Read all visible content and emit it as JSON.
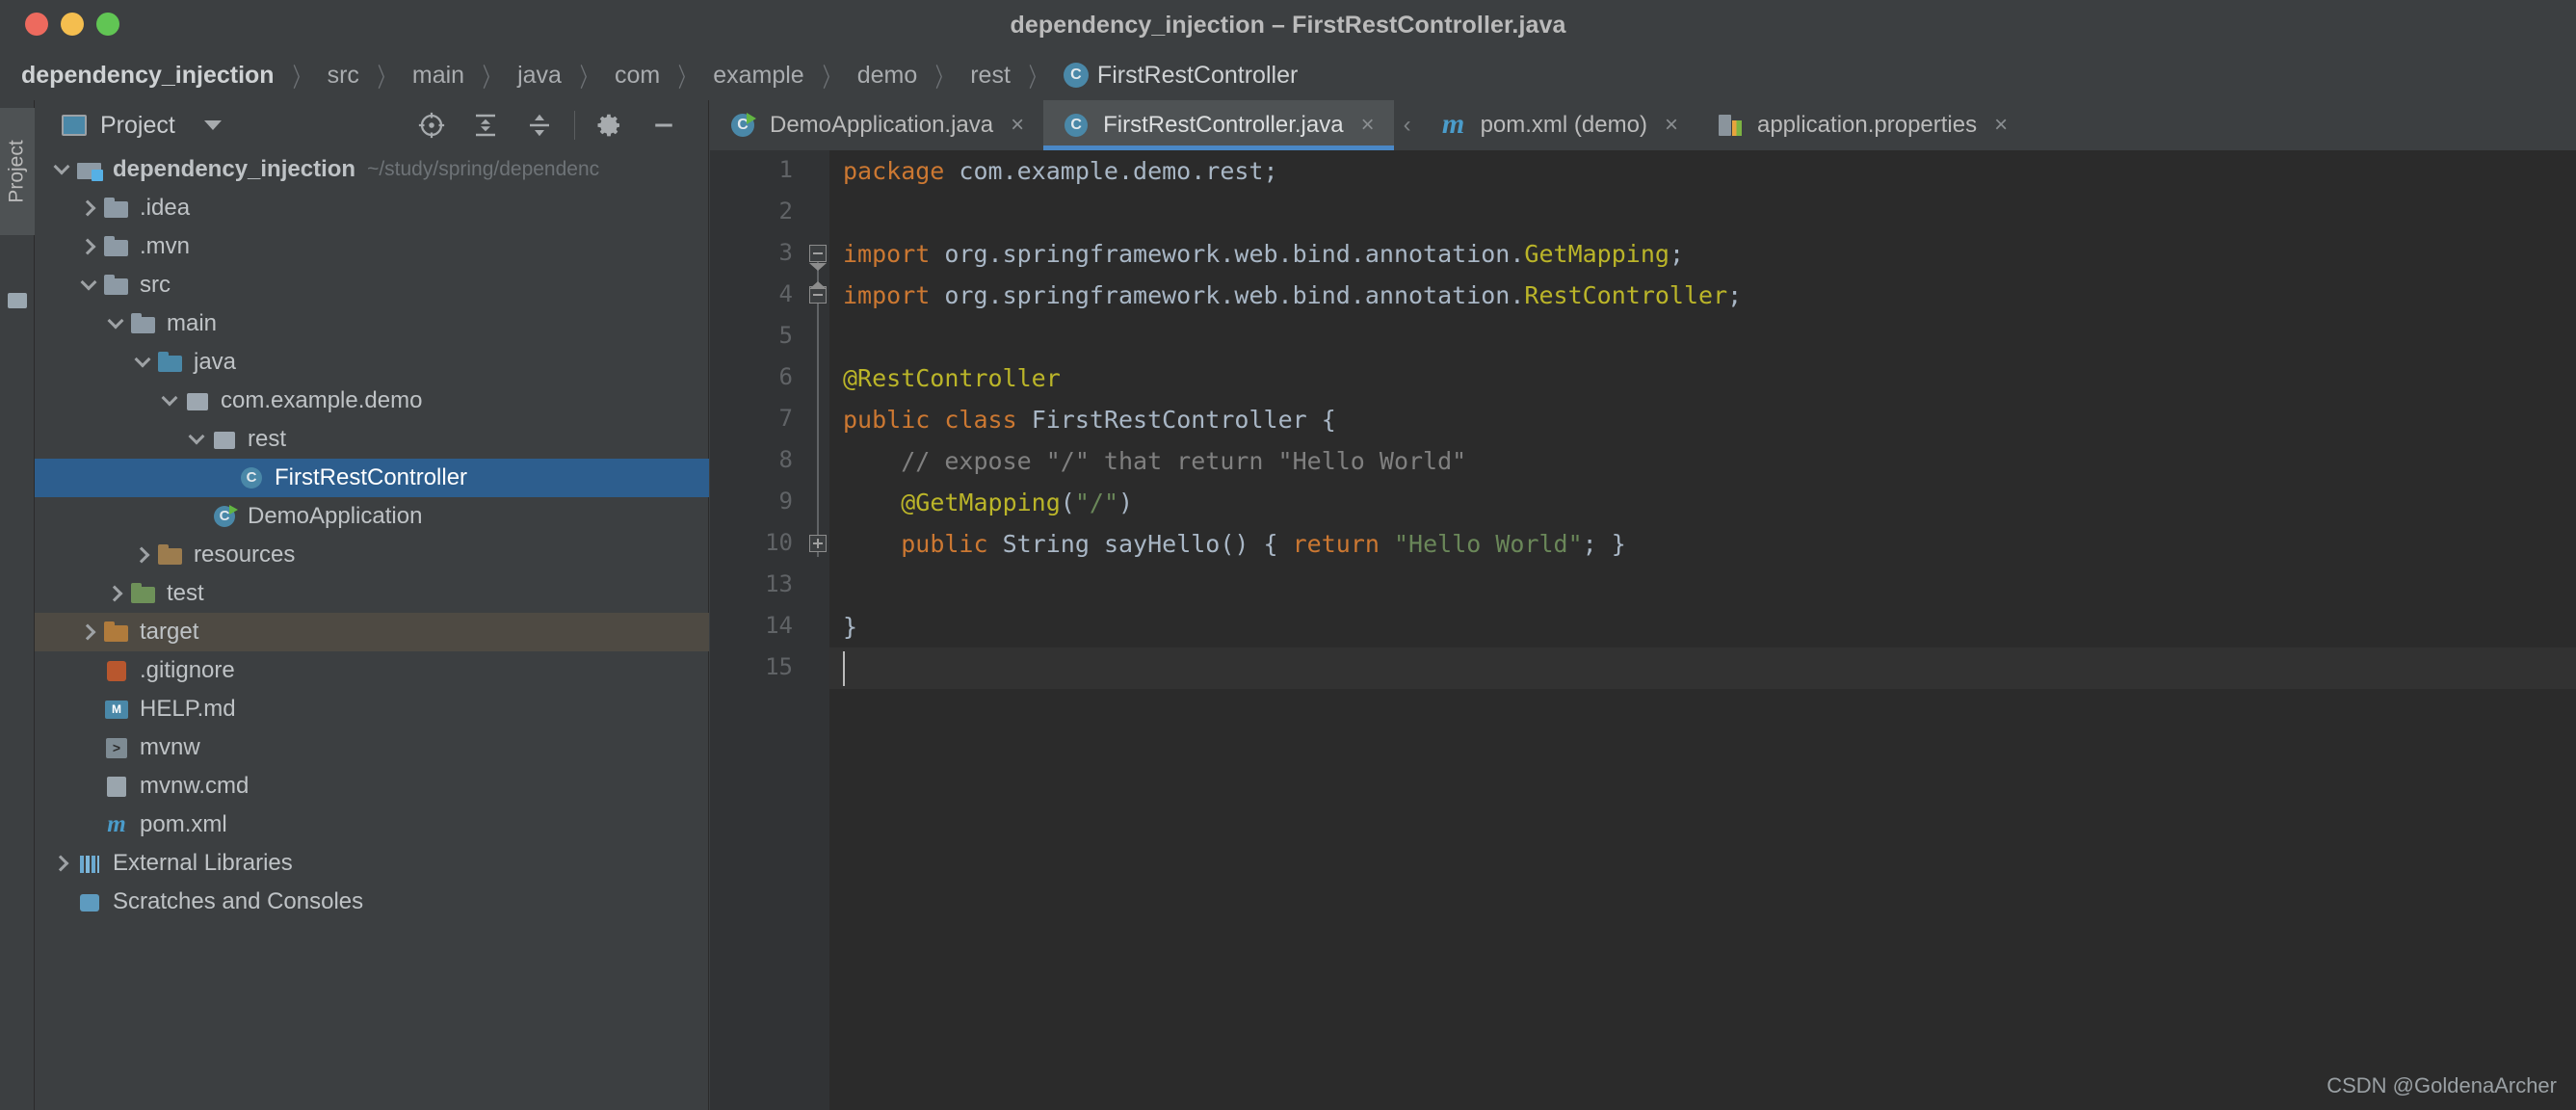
{
  "window": {
    "title": "dependency_injection – FirstRestController.java",
    "traffic_lights": [
      "close-red",
      "minimize-yellow",
      "zoom-green"
    ]
  },
  "breadcrumb": {
    "items": [
      "dependency_injection",
      "src",
      "main",
      "java",
      "com",
      "example",
      "demo",
      "rest"
    ],
    "current_class": "FirstRestController",
    "separator": "〉"
  },
  "left_strip": {
    "tool_tab": "Project"
  },
  "project_panel": {
    "title": "Project",
    "caret": "chevron-down-icon",
    "tools": [
      {
        "name": "locate-icon",
        "label": "Select Opened File"
      },
      {
        "name": "expand-all-icon",
        "label": "Expand All"
      },
      {
        "name": "collapse-all-icon",
        "label": "Collapse All"
      },
      {
        "name": "gear-icon",
        "label": "Settings"
      },
      {
        "name": "minimize-icon",
        "label": "Hide"
      }
    ],
    "tree": [
      {
        "label": "dependency_injection",
        "path_suffix": "~/study/spring/dependenc",
        "icon": "module",
        "arrow": "down",
        "indent": 0,
        "bold": true,
        "state": "normal"
      },
      {
        "label": ".idea",
        "icon": "folder",
        "arrow": "right",
        "indent": 1,
        "state": "normal"
      },
      {
        "label": ".mvn",
        "icon": "folder",
        "arrow": "right",
        "indent": 1,
        "state": "normal"
      },
      {
        "label": "src",
        "icon": "folder",
        "arrow": "down",
        "indent": 1,
        "state": "normal"
      },
      {
        "label": "main",
        "icon": "folder",
        "arrow": "down",
        "indent": 2,
        "state": "normal"
      },
      {
        "label": "java",
        "icon": "folder-src",
        "arrow": "down",
        "indent": 3,
        "state": "normal"
      },
      {
        "label": "com.example.demo",
        "icon": "pkg",
        "arrow": "down",
        "indent": 4,
        "state": "normal"
      },
      {
        "label": "rest",
        "icon": "pkg",
        "arrow": "down",
        "indent": 5,
        "state": "normal"
      },
      {
        "label": "FirstRestController",
        "icon": "cls",
        "arrow": "none",
        "indent": 6,
        "state": "selected"
      },
      {
        "label": "DemoApplication",
        "icon": "cls-run",
        "arrow": "none",
        "indent": 5,
        "state": "normal"
      },
      {
        "label": "resources",
        "icon": "folder-res",
        "arrow": "right",
        "indent": 3,
        "state": "normal"
      },
      {
        "label": "test",
        "icon": "folder-test",
        "arrow": "right",
        "indent": 2,
        "state": "normal"
      },
      {
        "label": "target",
        "icon": "folder-target",
        "arrow": "right",
        "indent": 1,
        "state": "highlight"
      },
      {
        "label": ".gitignore",
        "icon": "file-gitignore",
        "arrow": "none",
        "indent": 1,
        "state": "normal"
      },
      {
        "label": "HELP.md",
        "icon": "file-md",
        "arrow": "none",
        "indent": 1,
        "state": "normal"
      },
      {
        "label": "mvnw",
        "icon": "file-sh",
        "arrow": "none",
        "indent": 1,
        "state": "normal"
      },
      {
        "label": "mvnw.cmd",
        "icon": "file-cmd",
        "arrow": "none",
        "indent": 1,
        "state": "normal"
      },
      {
        "label": "pom.xml",
        "icon": "file-maven",
        "arrow": "none",
        "indent": 1,
        "state": "normal"
      },
      {
        "label": "External Libraries",
        "icon": "lib",
        "arrow": "right",
        "indent": 0,
        "state": "normal"
      },
      {
        "label": "Scratches and Consoles",
        "icon": "scratch",
        "arrow": "none",
        "indent": 0,
        "state": "normal"
      }
    ]
  },
  "editor": {
    "tabs": [
      {
        "label": "DemoApplication.java",
        "icon": "java-class-run-icon",
        "active": false,
        "close": "×"
      },
      {
        "label": "FirstRestController.java",
        "icon": "java-class-icon",
        "active": true,
        "close": "×"
      },
      {
        "label": "pom.xml (demo)",
        "icon": "maven-icon",
        "active": false,
        "close": "×"
      },
      {
        "label": "application.properties",
        "icon": "properties-icon",
        "active": false,
        "close": "×"
      }
    ],
    "tab_scroll_left": "‹",
    "line_numbers": [
      "1",
      "2",
      "3",
      "4",
      "5",
      "6",
      "7",
      "8",
      "9",
      "10",
      "13",
      "14",
      "15"
    ],
    "active_line_index": 12,
    "code_lines": [
      [
        {
          "t": "package",
          "c": "kw"
        },
        {
          "t": " com.example.demo.rest;",
          "c": "plain"
        }
      ],
      [],
      [
        {
          "t": "import",
          "c": "kw"
        },
        {
          "t": " org.springframework.web.bind.annotation.",
          "c": "plain"
        },
        {
          "t": "GetMapping",
          "c": "ann"
        },
        {
          "t": ";",
          "c": "plain"
        }
      ],
      [
        {
          "t": "import",
          "c": "kw"
        },
        {
          "t": " org.springframework.web.bind.annotation.",
          "c": "plain"
        },
        {
          "t": "RestController",
          "c": "ann"
        },
        {
          "t": ";",
          "c": "plain"
        }
      ],
      [],
      [
        {
          "t": "@RestController",
          "c": "ann"
        }
      ],
      [
        {
          "t": "public",
          "c": "kw"
        },
        {
          "t": " ",
          "c": "plain"
        },
        {
          "t": "class",
          "c": "kw"
        },
        {
          "t": " FirstRestController {",
          "c": "plain"
        }
      ],
      [
        {
          "t": "    // expose \"/\" that return \"Hello World\"",
          "c": "cmt"
        }
      ],
      [
        {
          "t": "    ",
          "c": "plain"
        },
        {
          "t": "@GetMapping",
          "c": "ann"
        },
        {
          "t": "(",
          "c": "plain"
        },
        {
          "t": "\"/\"",
          "c": "str"
        },
        {
          "t": ")",
          "c": "plain"
        }
      ],
      [
        {
          "t": "    ",
          "c": "plain"
        },
        {
          "t": "public",
          "c": "kw"
        },
        {
          "t": " String sayHello() { ",
          "c": "plain"
        },
        {
          "t": "return",
          "c": "kw"
        },
        {
          "t": " ",
          "c": "plain"
        },
        {
          "t": "\"Hello World\"",
          "c": "str"
        },
        {
          "t": "; }",
          "c": "plain"
        }
      ],
      [],
      [
        {
          "t": "}",
          "c": "plain"
        }
      ],
      []
    ],
    "colors": {
      "background": "#2B2B2B",
      "gutter": "#313335",
      "keyword": "#CC7832",
      "string": "#6A8759",
      "annotation": "#BBB529",
      "comment": "#808080",
      "identifier": "#A9B7C6",
      "line_number": "#606366",
      "active_tab_underline": "#4A88C7",
      "selection": "#2D5E8E"
    }
  },
  "watermark": {
    "text": "CSDN @GoldenaArcher"
  }
}
